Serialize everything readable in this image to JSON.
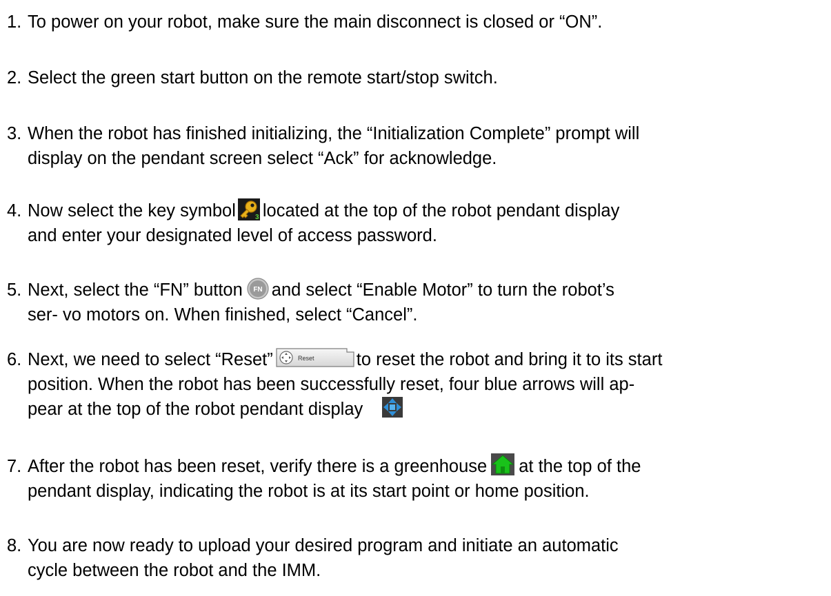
{
  "steps": [
    {
      "number": "1.",
      "lines": [
        "To power on your robot, make sure the main disconnect is closed or “ON”."
      ]
    },
    {
      "number": "2.",
      "lines": [
        "Select the green start button on the remote start/stop switch."
      ]
    },
    {
      "number": "3.",
      "lines": [
        "When the robot has finished initializing, the “Initialization Complete” prompt will",
        "display on the pendant screen select “Ack” for acknowledge."
      ]
    },
    {
      "number": "4.",
      "line1_before": "Now select the key symbol",
      "line1_after": "located at the top of the robot pendant display",
      "line2": "and enter your designated level of access password.",
      "icon": "key-icon",
      "icon_badge": "3"
    },
    {
      "number": "5.",
      "line1_before": "Next, select the “FN” button",
      "line1_after": "and select “Enable Motor” to turn the robot’s",
      "line2": "ser- vo motors on. When finished, select “Cancel”.",
      "icon": "fn-button-icon",
      "icon_label": "FN"
    },
    {
      "number": "6.",
      "line1_before": "Next, we need to select “Reset”",
      "line1_after": "to reset the robot and bring it to its start",
      "line2": "position. When the robot has been successfully reset, four blue arrows will ap-",
      "line3": "pear at the top of the robot pendant display",
      "icon": "reset-button-icon",
      "icon_label": "Reset",
      "icon2": "four-blue-arrows-icon"
    },
    {
      "number": "7.",
      "line1_before": "After the robot has been reset, verify there is a greenhouse",
      "line1_after": "at the top of the",
      "line2": "pendant display, indicating the robot is at its start point or home position.",
      "icon": "greenhouse-icon"
    },
    {
      "number": "8.",
      "lines": [
        "You are now ready to upload your desired program and initiate an automatic",
        "cycle between the robot and the IMM."
      ]
    }
  ],
  "colors": {
    "text": "#000000",
    "key_gold": "#e8b11c",
    "fn_gray": "#9a9a9a",
    "arrow_blue": "#2f8fd8",
    "home_green": "#19c21a"
  }
}
